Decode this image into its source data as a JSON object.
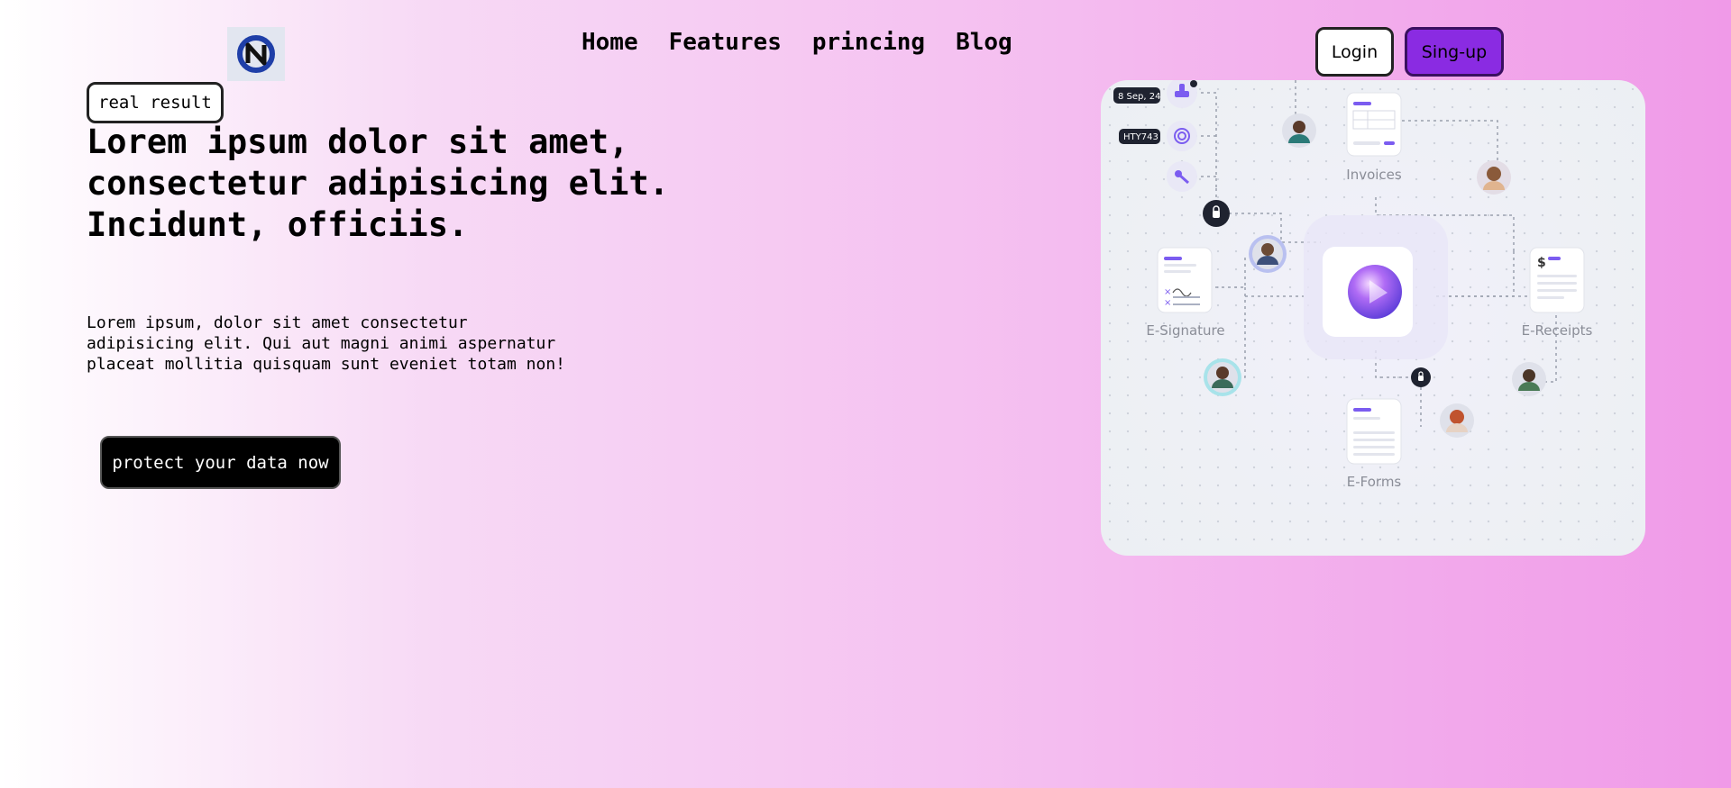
{
  "header": {
    "nav": [
      "Home",
      "Features",
      "princing",
      "Blog"
    ],
    "login_label": "Login",
    "signup_label": "Sing-up"
  },
  "hero": {
    "badge": "real result",
    "headline_lines": [
      "Lorem ipsum dolor sit amet,",
      "consectetur adipisicing elit.",
      "Incidunt, officiis."
    ],
    "description_lines": [
      "Lorem ipsum, dolor sit amet consectetur",
      "adipisicing elit. Qui aut magni animi aspernatur",
      "placeat mollitia quisquam sunt eveniet totam non!"
    ],
    "cta_label": "protect your data now"
  },
  "illustration": {
    "date_tag": "8 Sep, 24",
    "id_tag": "HTY743",
    "nodes": [
      "Invoices",
      "E-Signature",
      "E-Receipts",
      "E-Forms"
    ],
    "currency_symbol": "$"
  },
  "colors": {
    "signup_bg": "#8a2be2",
    "accent_purple": "#7b5cf0",
    "cta_bg": "#000000"
  }
}
